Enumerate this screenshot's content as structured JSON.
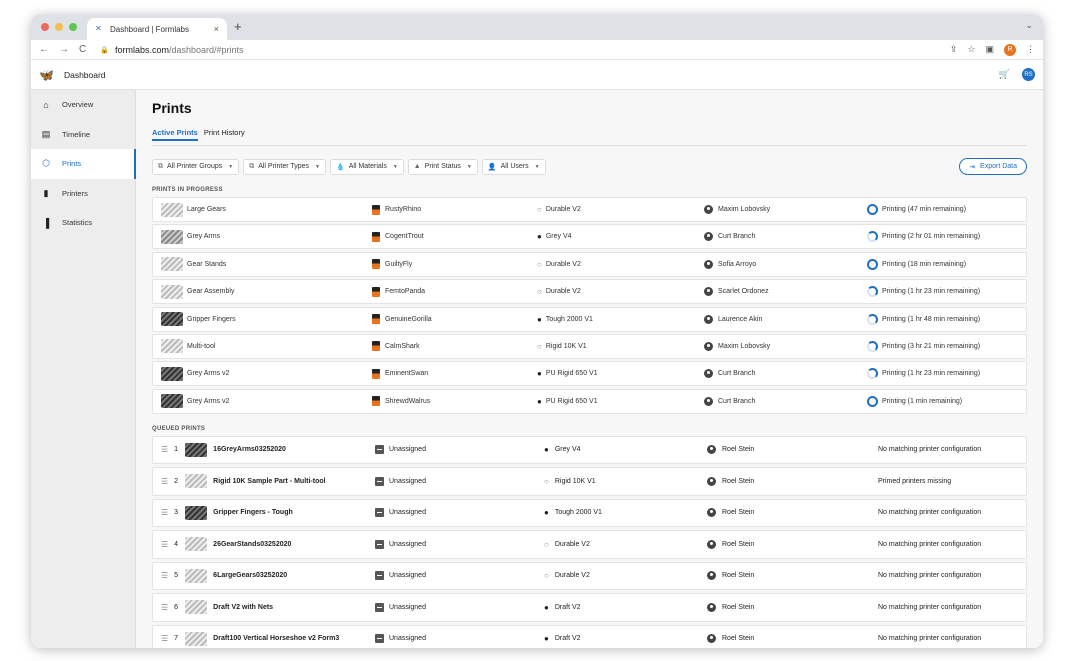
{
  "browser": {
    "tab_title": "Dashboard | Formlabs",
    "url_domain": "formlabs.com",
    "url_path": "/dashboard/#prints",
    "profile_initial": "R"
  },
  "header": {
    "title": "Dashboard",
    "avatar_initials": "RS"
  },
  "sidebar": {
    "items": [
      {
        "label": "Overview",
        "icon": "home-icon"
      },
      {
        "label": "Timeline",
        "icon": "calendar-icon"
      },
      {
        "label": "Prints",
        "icon": "cube-icon"
      },
      {
        "label": "Printers",
        "icon": "printer-icon"
      },
      {
        "label": "Statistics",
        "icon": "bar-chart-icon"
      }
    ],
    "active": "Prints"
  },
  "page": {
    "title": "Prints",
    "tabs": [
      "Active Prints",
      "Print History"
    ],
    "filters": [
      "All Printer Groups",
      "All Printer Types",
      "All Materials",
      "Print Status",
      "All Users"
    ],
    "export_label": "Export Data",
    "in_progress_heading": "PRINTS IN PROGRESS",
    "queued_heading": "QUEUED PRINTS"
  },
  "in_progress": [
    {
      "name": "Large Gears",
      "printer": "RustyRhino",
      "material": "Durable V2",
      "user": "Maxim Lobovsky",
      "status": "Printing (47 min remaining)"
    },
    {
      "name": "Grey Arms",
      "printer": "CogentTrout",
      "material": "Grey V4",
      "user": "Curt Branch",
      "status": "Printing (2 hr 01 min remaining)"
    },
    {
      "name": "Gear Stands",
      "printer": "GuiltyFly",
      "material": "Durable V2",
      "user": "Sofia Arroyo",
      "status": "Printing (18 min remaining)"
    },
    {
      "name": "Gear Assembly",
      "printer": "FemtoPanda",
      "material": "Durable V2",
      "user": "Scarlet Ordonez",
      "status": "Printing (1 hr 23 min remaining)"
    },
    {
      "name": "Gripper Fingers",
      "printer": "GenuineGorilla",
      "material": "Tough 2000 V1",
      "user": "Laurence Akin",
      "status": "Printing (1 hr 48 min remaining)"
    },
    {
      "name": "Multi-tool",
      "printer": "CalmShark",
      "material": "Rigid 10K V1",
      "user": "Maxim Lobovsky",
      "status": "Printing (3 hr 21 min remaining)"
    },
    {
      "name": "Grey Arms v2",
      "printer": "EminentSwan",
      "material": "PU Rigid 650 V1",
      "user": "Curt Branch",
      "status": "Printing (1 hr 23 min remaining)"
    },
    {
      "name": "Grey Arms v2",
      "printer": "ShrewdWalrus",
      "material": "PU Rigid 650 V1",
      "user": "Curt Branch",
      "status": "Printing (1 min remaining)"
    }
  ],
  "queued": [
    {
      "num": "1",
      "name": "16GreyArms03252020",
      "printer": "Unassigned",
      "material": "Grey V4",
      "user": "Roel Stein",
      "status": "No matching printer configuration"
    },
    {
      "num": "2",
      "name": "Rigid 10K Sample Part - Multi-tool",
      "printer": "Unassigned",
      "material": "Rigid 10K V1",
      "user": "Roel Stein",
      "status": "Primed printers missing"
    },
    {
      "num": "3",
      "name": "Gripper Fingers - Tough",
      "printer": "Unassigned",
      "material": "Tough 2000 V1",
      "user": "Roel Stein",
      "status": "No matching printer configuration"
    },
    {
      "num": "4",
      "name": "26GearStands03252020",
      "printer": "Unassigned",
      "material": "Durable V2",
      "user": "Roel Stein",
      "status": "No matching printer configuration"
    },
    {
      "num": "5",
      "name": "6LargeGears03252020",
      "printer": "Unassigned",
      "material": "Durable V2",
      "user": "Roel Stein",
      "status": "No matching printer configuration"
    },
    {
      "num": "6",
      "name": "Draft V2 with Nets",
      "printer": "Unassigned",
      "material": "Draft V2",
      "user": "Roel Stein",
      "status": "No matching printer configuration"
    },
    {
      "num": "7",
      "name": "Draft100 Vertical Horseshoe v2 Form3",
      "printer": "Unassigned",
      "material": "Draft V2",
      "user": "Roel Stein",
      "status": "No matching printer configuration"
    }
  ],
  "colors": {
    "accent": "#1f6fc5",
    "printer_orange": "#e8731f"
  }
}
